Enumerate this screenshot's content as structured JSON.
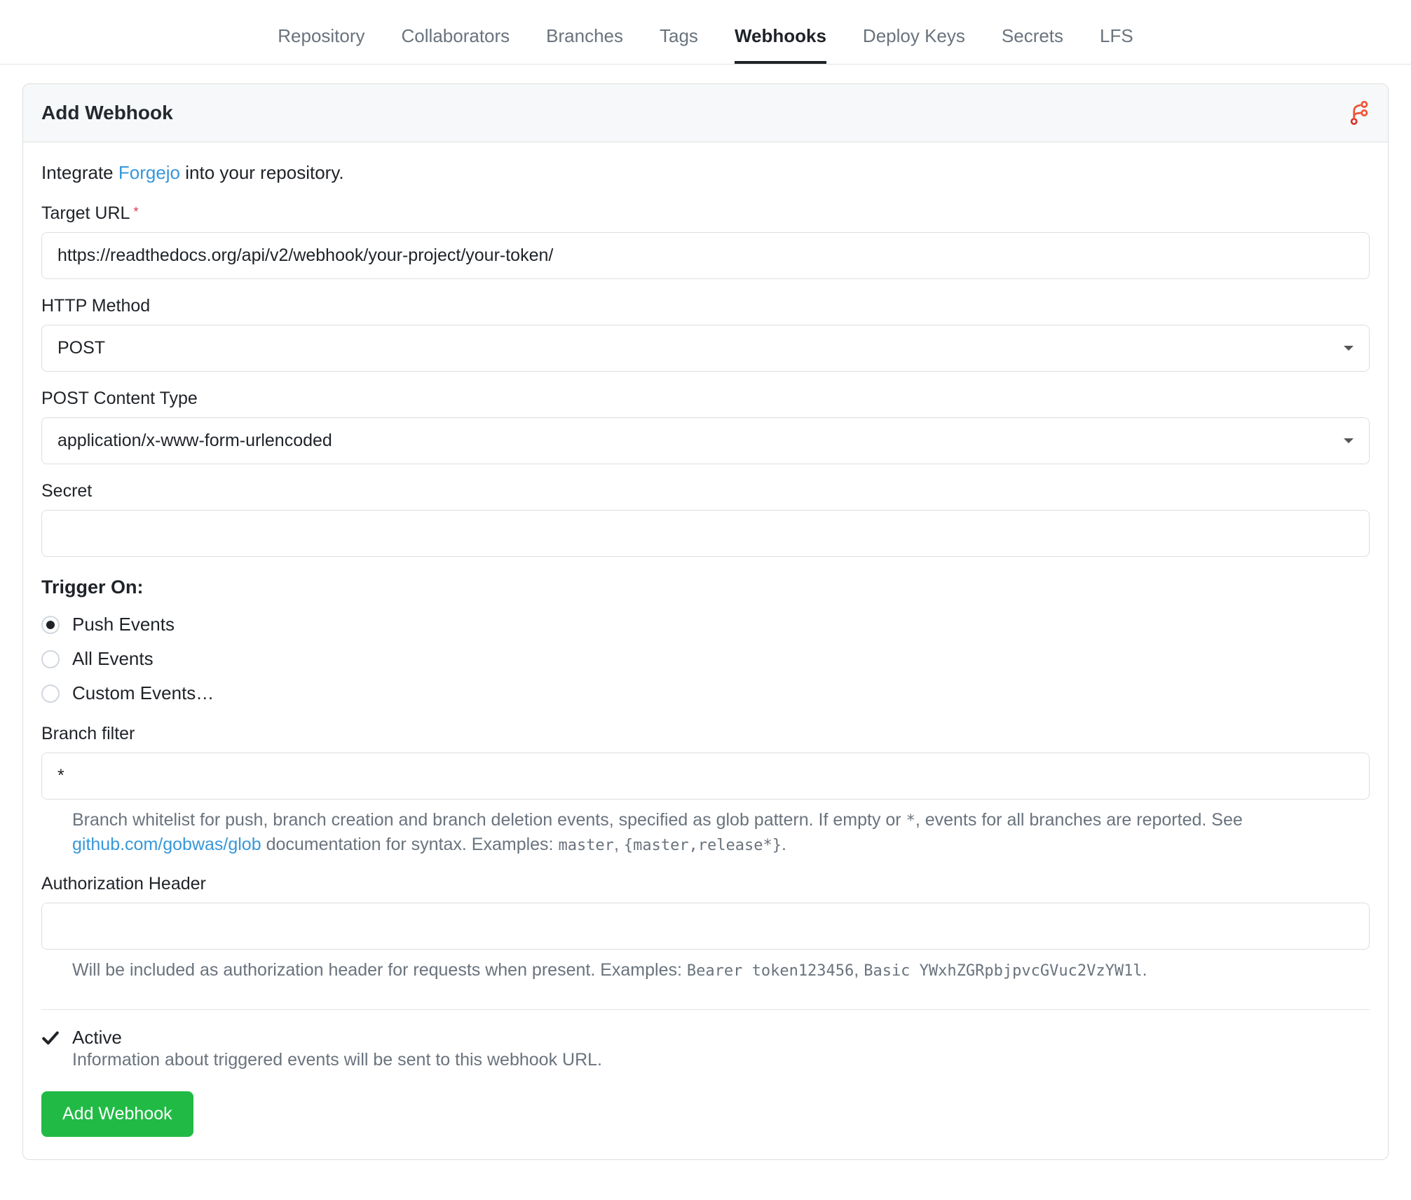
{
  "nav": {
    "tabs": [
      {
        "label": "Repository"
      },
      {
        "label": "Collaborators"
      },
      {
        "label": "Branches"
      },
      {
        "label": "Tags"
      },
      {
        "label": "Webhooks"
      },
      {
        "label": "Deploy Keys"
      },
      {
        "label": "Secrets"
      },
      {
        "label": "LFS"
      }
    ],
    "active_index": 4
  },
  "panel": {
    "title": "Add Webhook",
    "intro_prefix": "Integrate ",
    "intro_link": "Forgejo",
    "intro_suffix": " into your repository."
  },
  "form": {
    "target_url": {
      "label": "Target URL",
      "value": "https://readthedocs.org/api/v2/webhook/your-project/your-token/"
    },
    "http_method": {
      "label": "HTTP Method",
      "value": "POST"
    },
    "content_type": {
      "label": "POST Content Type",
      "value": "application/x-www-form-urlencoded"
    },
    "secret": {
      "label": "Secret",
      "value": ""
    },
    "trigger_on": {
      "title": "Trigger On:",
      "options": [
        {
          "label": "Push Events"
        },
        {
          "label": "All Events"
        },
        {
          "label": "Custom Events…"
        }
      ],
      "selected_index": 0
    },
    "branch_filter": {
      "label": "Branch filter",
      "value": "*",
      "help_pre": "Branch whitelist for push, branch creation and branch deletion events, specified as glob pattern. If empty or ",
      "help_star": "*",
      "help_mid": ", events for all branches are reported. See ",
      "help_link": "github.com/gobwas/glob",
      "help_post": " documentation for syntax. Examples: ",
      "help_ex1": "master",
      "help_comma": ", ",
      "help_ex2": "{master,release*}",
      "help_end": "."
    },
    "auth_header": {
      "label": "Authorization Header",
      "value": "",
      "help_pre": "Will be included as authorization header for requests when present. Examples: ",
      "help_ex1": "Bearer token123456",
      "help_comma": ", ",
      "help_ex2": "Basic YWxhZGRpbjpvcGVuc2VzYW1l",
      "help_end": "."
    },
    "active": {
      "label": "Active",
      "desc": "Information about triggered events will be sent to this webhook URL."
    },
    "submit_label": "Add Webhook"
  },
  "colors": {
    "forgejo_orange": "#f05133",
    "link_blue": "#3797db",
    "btn_green": "#21ba45"
  }
}
